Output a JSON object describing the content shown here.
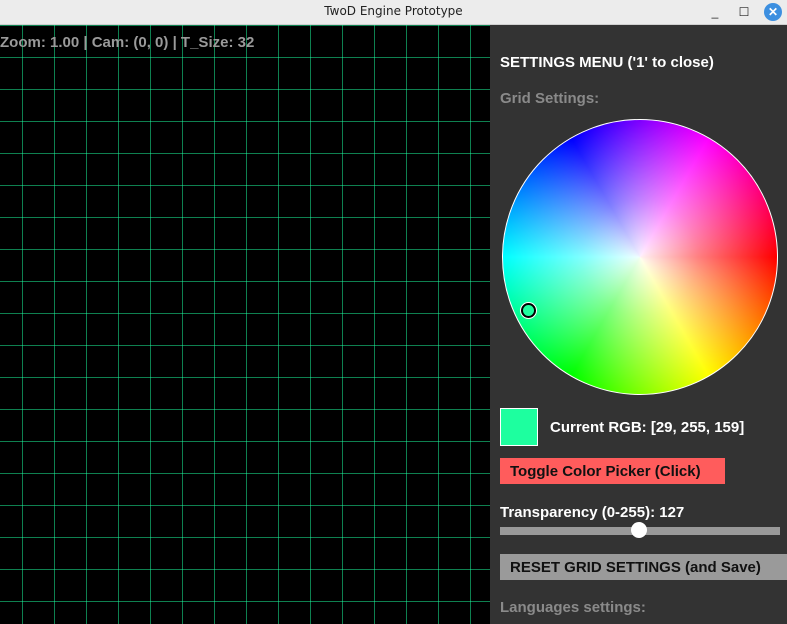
{
  "window": {
    "title": "TwoD Engine Prototype",
    "minimize_icon": "minimize-icon",
    "maximize_icon": "maximize-icon",
    "close_icon": "close-icon"
  },
  "hud": {
    "text": "Zoom: 1.00 | Cam: (0, 0) | T_Size: 32"
  },
  "settings": {
    "title": "SETTINGS MENU ('1' to close)",
    "grid_heading": "Grid Settings:",
    "current_rgb_label": "Current RGB: [29, 255, 159]",
    "current_color": "#1dff9f",
    "toggle_button": "Toggle Color Picker (Click)",
    "toggle_color": "#ff5c5c",
    "transparency_label": "Transparency (0-255): 127",
    "transparency_value": 127,
    "transparency_max": 255,
    "reset_button": "RESET GRID SETTINGS (and Save)",
    "languages_heading": "Languages settings:"
  }
}
